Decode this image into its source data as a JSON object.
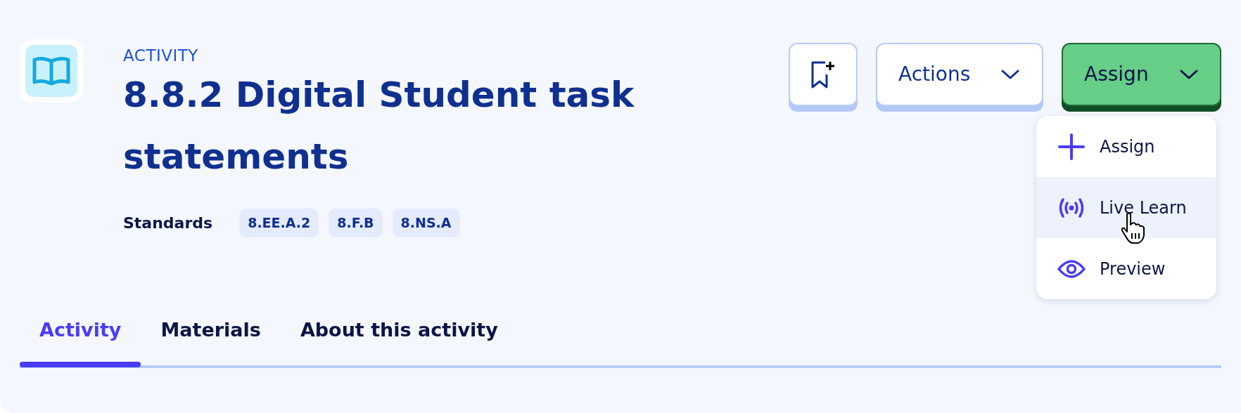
{
  "header": {
    "eyebrow": "ACTIVITY",
    "title": "8.8.2 Digital Student task statements",
    "standards_label": "Standards",
    "standards": [
      "8.EE.A.2",
      "8.F.B",
      "8.NS.A"
    ]
  },
  "actions": {
    "bookmark": {
      "kind": "bookmark"
    },
    "actions_button": {
      "label": "Actions"
    },
    "assign_button": {
      "label": "Assign"
    }
  },
  "assign_menu": [
    {
      "kind": "plus",
      "label": "Assign",
      "hovered": false
    },
    {
      "kind": "live",
      "label": "Live Learn",
      "hovered": true
    },
    {
      "kind": "eye",
      "label": "Preview",
      "hovered": false
    }
  ],
  "tabs": [
    {
      "label": "Activity",
      "selected": true
    },
    {
      "label": "Materials",
      "selected": false
    },
    {
      "label": "About this activity",
      "selected": false
    }
  ]
}
